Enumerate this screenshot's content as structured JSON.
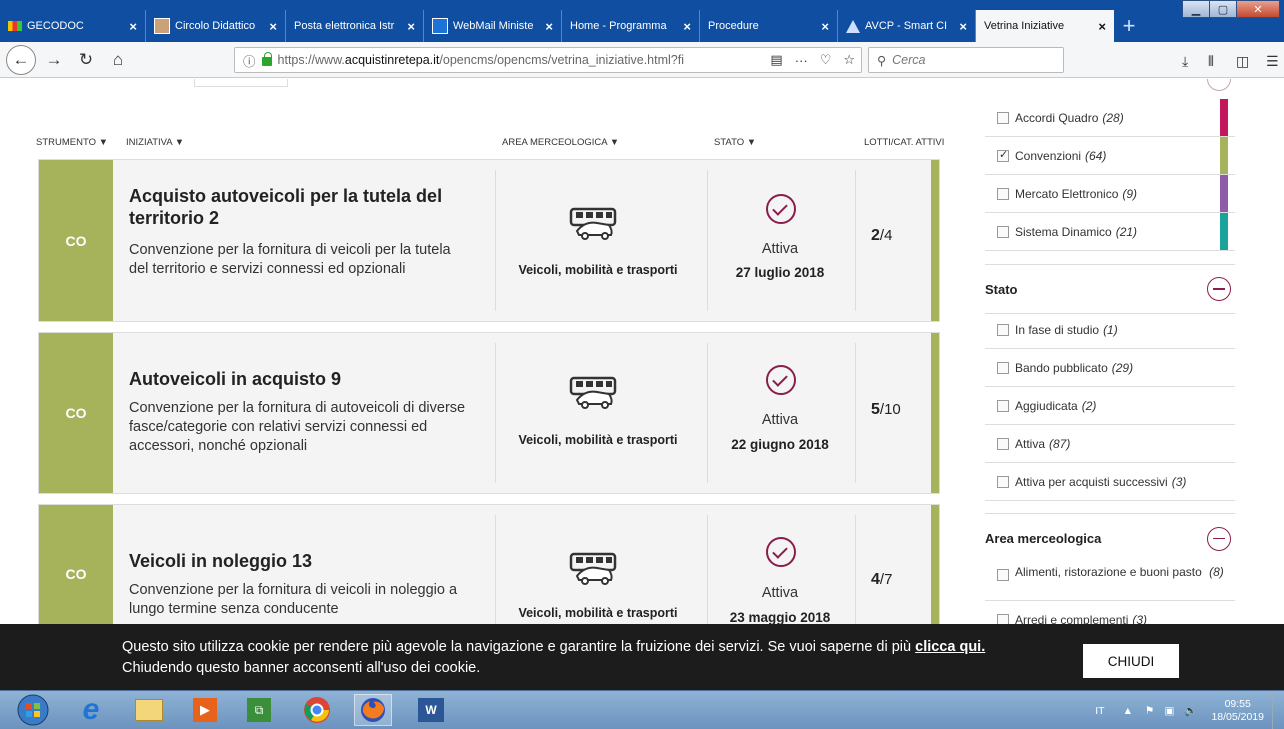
{
  "tabs": [
    {
      "title": "GECODOC",
      "active": false
    },
    {
      "title": "Circolo Didattico",
      "active": false
    },
    {
      "title": "Posta elettronica Istr",
      "active": false
    },
    {
      "title": "WebMail Ministe",
      "active": false
    },
    {
      "title": "Home - Programma",
      "active": false
    },
    {
      "title": "Procedure",
      "active": false
    },
    {
      "title": "AVCP - Smart CI",
      "active": false
    },
    {
      "title": "Vetrina Iniziative",
      "active": true
    }
  ],
  "tab_close": "×",
  "newtab": "+",
  "nav": {
    "back": "←",
    "forward": "→",
    "reload": "↻",
    "home": "⌂",
    "url_host": "https://www.",
    "url_domain": "acquistinretepa.it",
    "url_path": "/opencms/opencms/vetrina_iniziative.html?fi",
    "search_placeholder": "Cerca"
  },
  "columns": {
    "strumento": "STRUMENTO ▼",
    "iniziativa": "INIZIATIVA ▼",
    "area": "AREA MERCEOLOGICA ▼",
    "stato": "STATO ▼",
    "lotti": "LOTTI/CAT. ATTIVI"
  },
  "cards": [
    {
      "tag": "CO",
      "title": "Acquisto autoveicoli per la tutela del territorio 2",
      "desc": "Convenzione per la fornitura di veicoli per la tutela del territorio e servizi connessi ed opzionali",
      "area": "Veicoli, mobilità e trasporti",
      "stato": "Attiva",
      "data": "27 luglio 2018",
      "lotti_a": "2",
      "lotti_b": "/4"
    },
    {
      "tag": "CO",
      "title": "Autoveicoli in acquisto 9",
      "desc": "Convenzione per la fornitura di autoveicoli di diverse fasce/categorie con relativi servizi connessi ed accessori, nonché opzionali",
      "area": "Veicoli, mobilità e trasporti",
      "stato": "Attiva",
      "data": "22 giugno 2018",
      "lotti_a": "5",
      "lotti_b": "/10"
    },
    {
      "tag": "CO",
      "title": "Veicoli in noleggio 13",
      "desc": "Convenzione per la fornitura di veicoli in noleggio a lungo termine senza conducente",
      "area": "Veicoli, mobilità e trasporti",
      "stato": "Attiva",
      "data": "23 maggio 2018",
      "lotti_a": "4",
      "lotti_b": "/7"
    }
  ],
  "filters": {
    "strumento": [
      {
        "label": "Accordi Quadro",
        "count": "(28)",
        "checked": false,
        "color": "#c2185b"
      },
      {
        "label": "Convenzioni",
        "count": "(64)",
        "checked": true,
        "color": "#a6b35b"
      },
      {
        "label": "Mercato Elettronico",
        "count": "(9)",
        "checked": false,
        "color": "#8e5ba6"
      },
      {
        "label": "Sistema Dinamico",
        "count": "(21)",
        "checked": false,
        "color": "#1aa39b"
      }
    ],
    "stato_title": "Stato",
    "stato": [
      {
        "label": "In fase di studio",
        "count": "(1)"
      },
      {
        "label": "Bando pubblicato",
        "count": "(29)"
      },
      {
        "label": "Aggiudicata",
        "count": "(2)"
      },
      {
        "label": "Attiva",
        "count": "(87)"
      },
      {
        "label": "Attiva per acquisti successivi",
        "count": "(3)"
      }
    ],
    "area_title": "Area merceologica",
    "area": [
      {
        "label": "Alimenti, ristorazione e buoni pasto",
        "count": "(8)"
      },
      {
        "label": "Arredi e complementi",
        "count": "(3)"
      }
    ]
  },
  "cookie": {
    "text": "Questo sito utilizza cookie per rendere più agevole la navigazione e garantire la fruizione dei servizi. Se vuoi saperne di più ",
    "link": "clicca qui.",
    "text2": "Chiudendo questo banner acconsenti all'uso dei cookie.",
    "button": "CHIUDI"
  },
  "taskbar": {
    "lang": "IT",
    "time": "09:55",
    "date": "18/05/2019"
  }
}
